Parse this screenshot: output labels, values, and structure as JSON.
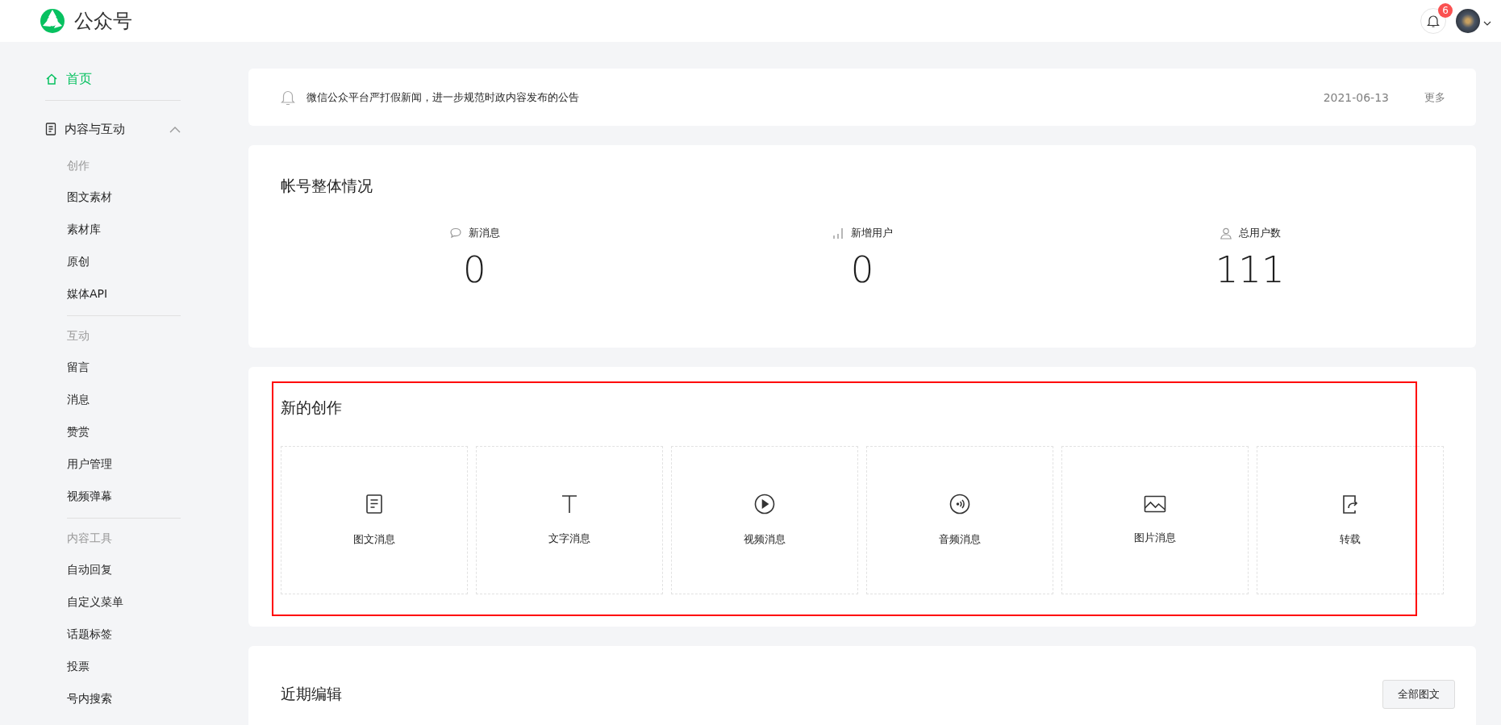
{
  "header": {
    "logo_text": "公众号",
    "notifications": {
      "count": "6"
    }
  },
  "sidebar": {
    "home": {
      "label": "首页",
      "selected": true
    },
    "groups": [
      {
        "label": "内容与互动",
        "expanded": true,
        "sections": [
          {
            "heading": "创作",
            "items": [
              {
                "label": "图文素材",
                "selected": false
              },
              {
                "label": "素材库",
                "selected": false
              },
              {
                "label": "原创",
                "selected": false
              },
              {
                "label": "媒体API",
                "selected": false
              }
            ]
          },
          {
            "heading": "互动",
            "items": [
              {
                "label": "留言",
                "selected": false
              },
              {
                "label": "消息",
                "selected": false
              },
              {
                "label": "赞赏",
                "selected": false
              },
              {
                "label": "用户管理",
                "selected": false
              },
              {
                "label": "视频弹幕",
                "selected": false
              }
            ]
          },
          {
            "heading": "内容工具",
            "items": [
              {
                "label": "自动回复",
                "selected": false
              },
              {
                "label": "自定义菜单",
                "selected": false
              },
              {
                "label": "话题标签",
                "selected": false
              },
              {
                "label": "投票",
                "selected": false
              },
              {
                "label": "号内搜索",
                "selected": false
              }
            ]
          }
        ]
      }
    ]
  },
  "notice": {
    "text": "微信公众平台严打假新闻，进一步规范时政内容发布的公告",
    "date": "2021-06-13",
    "more": "更多"
  },
  "account_overview": {
    "title": "帐号整体情况",
    "stats": [
      {
        "kind": "message",
        "label": "新消息",
        "value": "0"
      },
      {
        "kind": "growth",
        "label": "新增用户",
        "value": "0"
      },
      {
        "kind": "users",
        "label": "总用户数",
        "value": "111"
      }
    ]
  },
  "new_creation": {
    "title": "新的创作",
    "highlighted": true,
    "options": [
      {
        "kind": "article",
        "label": "图文消息"
      },
      {
        "kind": "text",
        "label": "文字消息"
      },
      {
        "kind": "video",
        "label": "视频消息"
      },
      {
        "kind": "audio",
        "label": "音频消息"
      },
      {
        "kind": "image",
        "label": "图片消息"
      },
      {
        "kind": "repost",
        "label": "转载"
      }
    ]
  },
  "recent_edits": {
    "title": "近期编辑",
    "button": "全部图文"
  }
}
